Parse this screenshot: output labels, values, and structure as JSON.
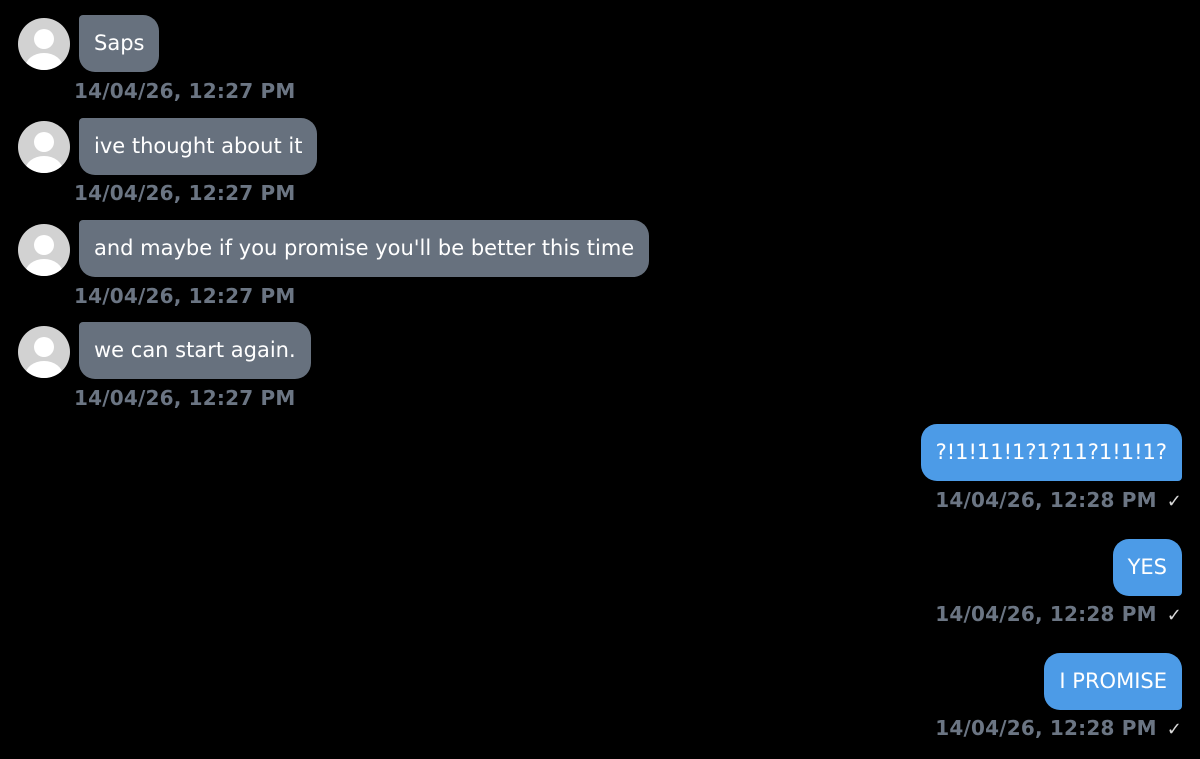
{
  "conversation": {
    "incoming": [
      {
        "text": "Saps",
        "timestamp": "14/04/26, 12:27 PM"
      },
      {
        "text": "ive thought about it",
        "timestamp": "14/04/26, 12:27 PM"
      },
      {
        "text": "and maybe if you promise you'll be better this time",
        "timestamp": "14/04/26, 12:27 PM"
      },
      {
        "text": "we can start again.",
        "timestamp": "14/04/26, 12:27 PM"
      }
    ],
    "outgoing": [
      {
        "text": "?!1!11!1?1?11?1!1!1?",
        "timestamp": "14/04/26, 12:28 PM",
        "status_icon": "checkmark-icon"
      },
      {
        "text": "YES",
        "timestamp": "14/04/26, 12:28 PM",
        "status_icon": "checkmark-icon"
      },
      {
        "text": "I PROMISE",
        "timestamp": "14/04/26, 12:28 PM",
        "status_icon": "checkmark-icon"
      }
    ]
  },
  "colors": {
    "background": "#000000",
    "incoming_bubble": "#67717e",
    "outgoing_bubble": "#4c9be7",
    "timestamp": "#6b7583"
  }
}
